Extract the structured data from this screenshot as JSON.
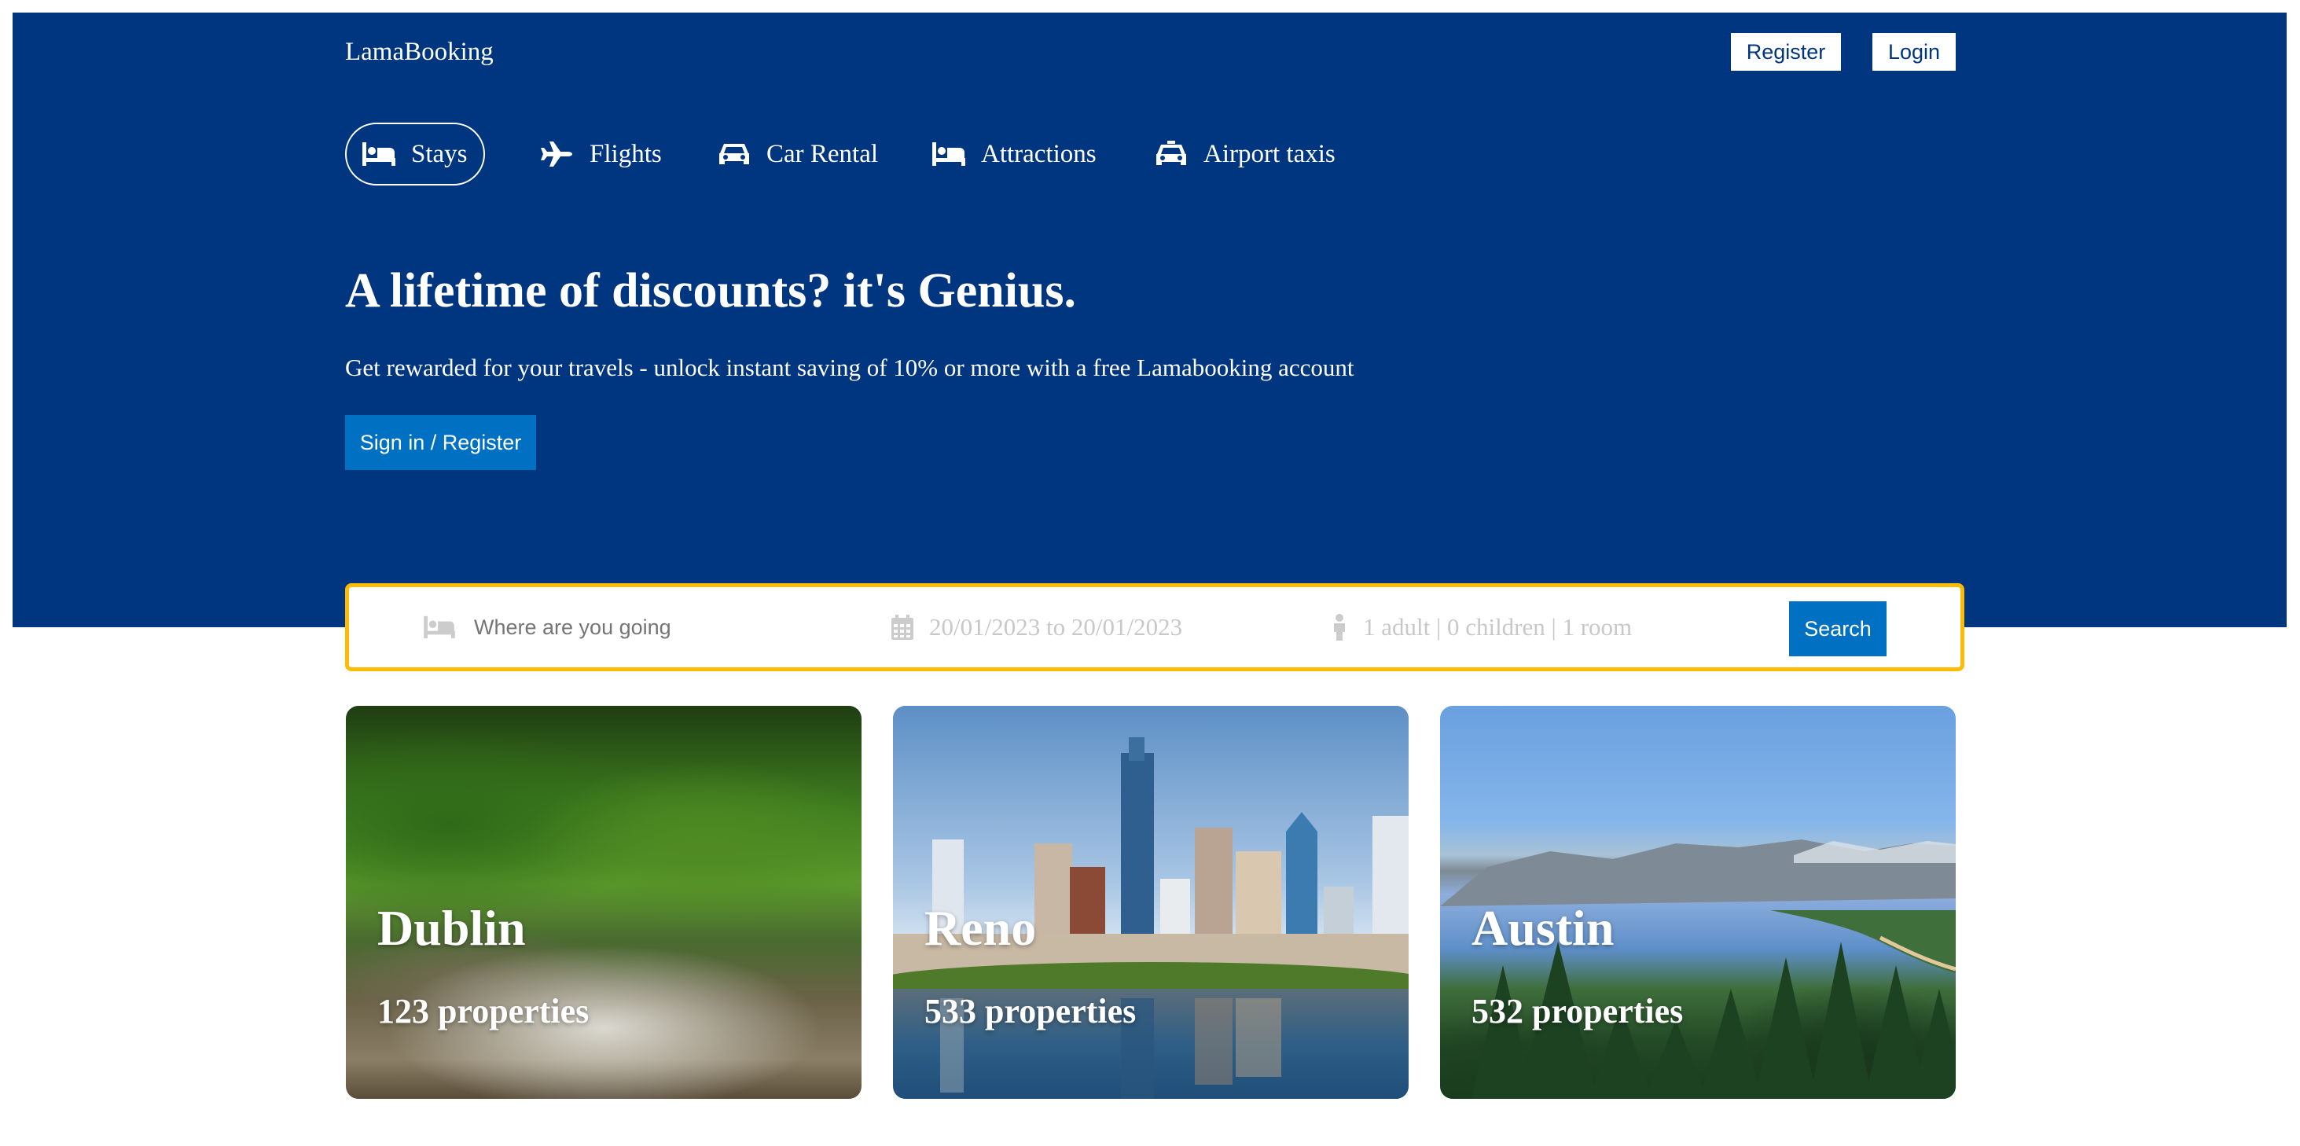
{
  "header": {
    "logo": "LamaBooking",
    "register_label": "Register",
    "login_label": "Login"
  },
  "nav": {
    "items": [
      {
        "label": "Stays",
        "icon": "bed-icon",
        "active": true
      },
      {
        "label": "Flights",
        "icon": "plane-icon",
        "active": false
      },
      {
        "label": "Car Rental",
        "icon": "car-icon",
        "active": false
      },
      {
        "label": "Attractions",
        "icon": "bed-icon",
        "active": false
      },
      {
        "label": "Airport taxis",
        "icon": "taxi-icon",
        "active": false
      }
    ]
  },
  "hero": {
    "title": "A lifetime of discounts? it's Genius.",
    "subtitle": "Get rewarded for your travels - unlock instant saving of 10% or more with a free Lamabooking account",
    "cta_label": "Sign in / Register"
  },
  "search": {
    "destination_placeholder": "Where are you going",
    "date_range": "20/01/2023 to 20/01/2023",
    "guests": "1 adult | 0 children | 1 room",
    "button_label": "Search"
  },
  "featured": [
    {
      "city": "Dublin",
      "count": "123 properties"
    },
    {
      "city": "Reno",
      "count": "533 properties"
    },
    {
      "city": "Austin",
      "count": "532 properties"
    }
  ],
  "colors": {
    "brand_blue": "#003580",
    "button_blue": "#0071c2",
    "search_border": "#febb02"
  }
}
